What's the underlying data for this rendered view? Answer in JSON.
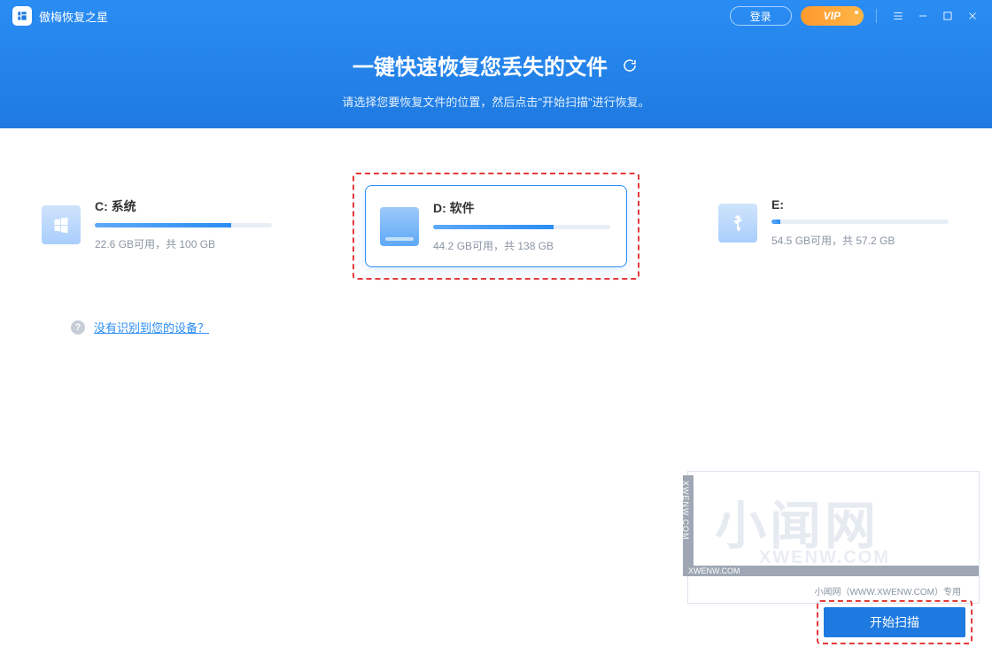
{
  "app": {
    "title": "傲梅恢复之星",
    "login_label": "登录",
    "vip_label": "VIP"
  },
  "headline": "一键快速恢复您丢失的文件",
  "subline": "请选择您要恢复文件的位置，然后点击\"开始扫描\"进行恢复。",
  "drives": [
    {
      "name": "C: 系统",
      "usage": "22.6 GB可用，共 100 GB",
      "fill_pct": 77,
      "icon": "windows",
      "selected": false
    },
    {
      "name": "D: 软件",
      "usage": "44.2 GB可用，共 138 GB",
      "fill_pct": 68,
      "icon": "hdd",
      "selected": true
    },
    {
      "name": "E:",
      "usage": "54.5 GB可用，共 57.2 GB",
      "fill_pct": 5,
      "icon": "usb",
      "selected": false
    }
  ],
  "help_link": "没有识别到您的设备？",
  "scan_button": "开始扫描",
  "watermark": {
    "side": "XWENW.COM",
    "bottom": "XWENW.COM",
    "big": "小闻网",
    "sub": "XWENW.COM",
    "caption": "小闻网（WWW.XWENW.COM）专用"
  },
  "colors": {
    "accent": "#1e7ae0",
    "highlight_dash": "#e23b3b"
  }
}
